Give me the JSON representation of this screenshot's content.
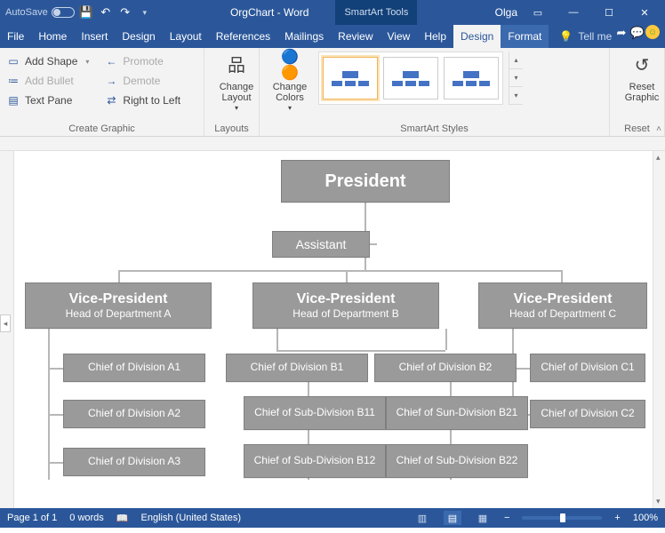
{
  "titlebar": {
    "autosave_label": "AutoSave",
    "doc_title": "OrgChart - Word",
    "tool_context": "SmartArt Tools",
    "user": "Olga"
  },
  "tabs": {
    "file": "File",
    "home": "Home",
    "insert": "Insert",
    "design": "Design",
    "layout": "Layout",
    "references": "References",
    "mailings": "Mailings",
    "review": "Review",
    "view": "View",
    "help": "Help",
    "sa_design": "Design",
    "sa_format": "Format",
    "tellme": "Tell me"
  },
  "ribbon": {
    "create": {
      "add_shape": "Add Shape",
      "add_bullet": "Add Bullet",
      "text_pane": "Text Pane",
      "promote": "Promote",
      "demote": "Demote",
      "rtl": "Right to Left",
      "label": "Create Graphic"
    },
    "layouts": {
      "btn": "Change Layout",
      "label": "Layouts"
    },
    "colors": {
      "btn": "Change Colors"
    },
    "styles_label": "SmartArt Styles",
    "reset": {
      "btn": "Reset Graphic",
      "label": "Reset"
    }
  },
  "org": {
    "president": "President",
    "assistant": "Assistant",
    "vp": [
      {
        "title": "Vice-President",
        "sub": "Head of Department A"
      },
      {
        "title": "Vice-President",
        "sub": "Head of Department B"
      },
      {
        "title": "Vice-President",
        "sub": "Head of Department C"
      }
    ],
    "a": [
      "Chief of Division A1",
      "Chief of Division A2",
      "Chief of Division A3"
    ],
    "b_top": [
      "Chief of Division B1",
      "Chief of Division B2"
    ],
    "b_sub": [
      "Chief of Sub-Division B11",
      "Chief of Sun-Division B21",
      "Chief of Sub-Division B12",
      "Chief of Sub-Division B22"
    ],
    "c": [
      "Chief of Division C1",
      "Chief of Division C2"
    ]
  },
  "status": {
    "page": "Page 1 of 1",
    "words": "0 words",
    "lang": "English (United States)",
    "zoom": "100%"
  }
}
